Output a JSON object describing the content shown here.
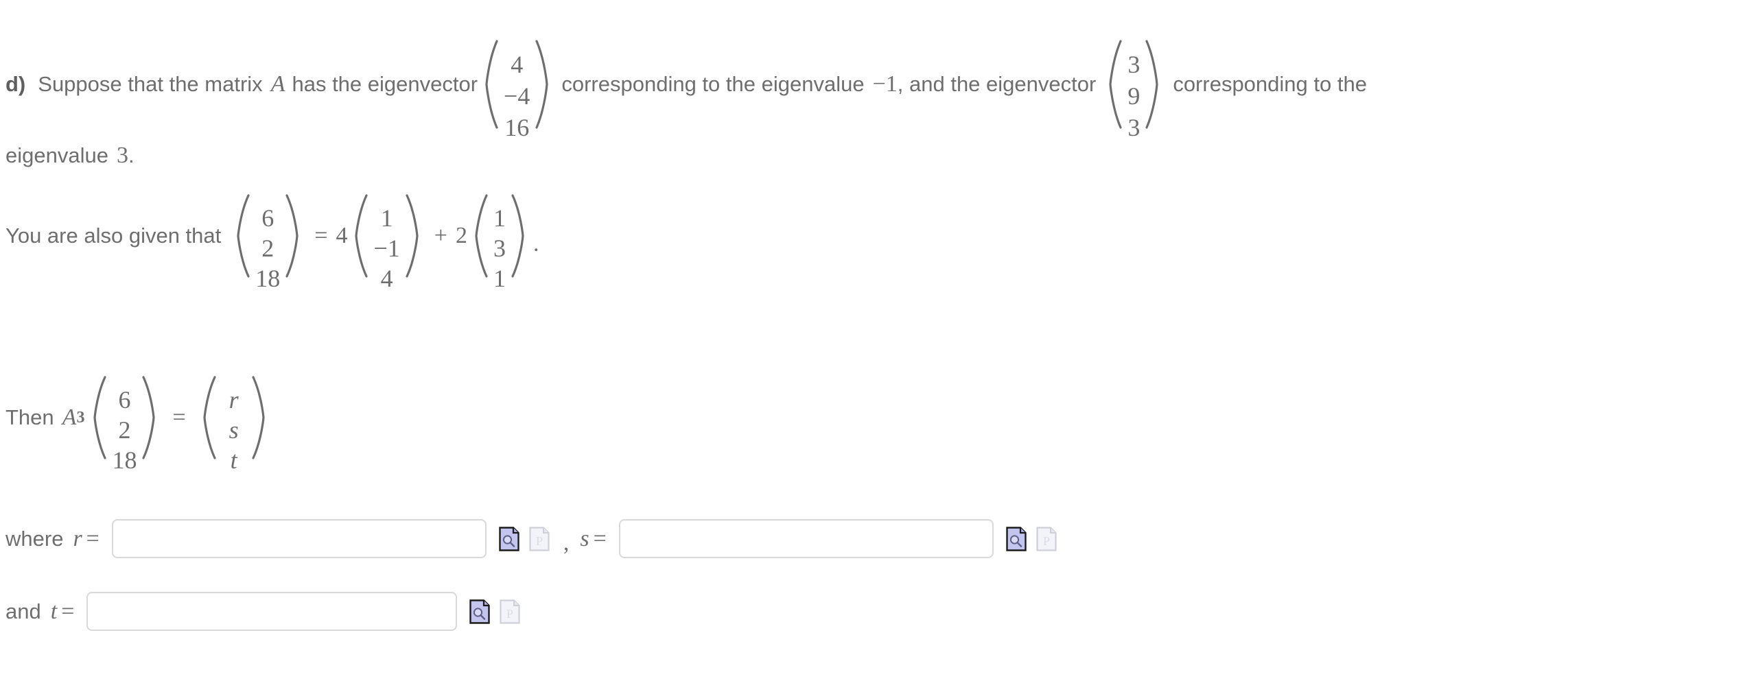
{
  "problem": {
    "part_label": "d)",
    "line1": {
      "text_a": "Suppose that the matrix",
      "matrix_symbol": "A",
      "text_b": "has the eigenvector",
      "eigenvector_1": [
        "4",
        "−4",
        "16"
      ],
      "text_c": "corresponding to the eigenvalue",
      "eigenvalue_1": "−1",
      "text_d": ", and the eigenvector",
      "eigenvector_2": [
        "3",
        "9",
        "3"
      ],
      "text_e": "corresponding to the"
    },
    "line2": {
      "text_a": "eigenvalue",
      "eigenvalue_2": "3",
      "text_b": "."
    },
    "line3": {
      "text_a": "You are also given that",
      "vector_lhs": [
        "6",
        "2",
        "18"
      ],
      "equals": "=",
      "coeff_1": "4",
      "vector_1": [
        "1",
        "−1",
        "4"
      ],
      "plus": "+",
      "coeff_2": "2",
      "vector_2": [
        "1",
        "3",
        "1"
      ],
      "period": "."
    },
    "line4": {
      "text_a": "Then",
      "matrix_symbol": "A",
      "exponent": "3",
      "vector_lhs": [
        "6",
        "2",
        "18"
      ],
      "equals": "=",
      "vector_rhs": [
        "r",
        "s",
        "t"
      ]
    },
    "line5": {
      "label_where": "where",
      "var_r": "r",
      "equals_r": "=",
      "input_r_value": "",
      "input_r_placeholder": "",
      "comma": ",",
      "var_s": "s",
      "equals_s": "=",
      "input_s_value": "",
      "input_s_placeholder": ""
    },
    "line6": {
      "label_and": "and",
      "var_t": "t",
      "equals_t": "=",
      "input_t_value": "",
      "input_t_placeholder": ""
    }
  },
  "icons": {
    "preview_name": "preview-magnifier-icon",
    "format_name": "answer-format-p-icon",
    "preview_fill": "#c3c5ef",
    "preview_stroke": "#1b1b1b",
    "format_fill": "#f3f3fa",
    "format_stroke": "#cfcfd8"
  },
  "colors": {
    "text": "#6e6e6e",
    "input_border": "#d9d9d9",
    "background": "#ffffff"
  }
}
